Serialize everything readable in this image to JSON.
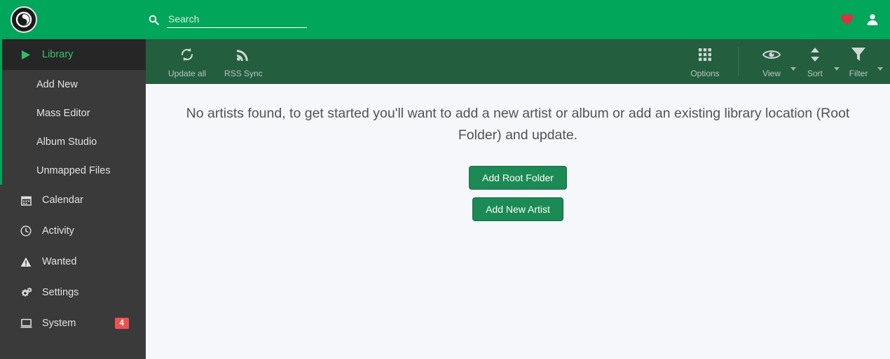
{
  "header": {
    "logo_icon": "lidarr-logo-icon",
    "search": {
      "placeholder": "Search",
      "value": "",
      "icon": "search-icon"
    },
    "donate_icon": "heart-icon",
    "account_icon": "user-icon"
  },
  "sidebar": {
    "groups": [
      {
        "active": true,
        "label": "Library",
        "icon": "play-triangle-icon",
        "children": [
          {
            "label": "Add New"
          },
          {
            "label": "Mass Editor"
          },
          {
            "label": "Album Studio"
          },
          {
            "label": "Unmapped Files"
          }
        ]
      }
    ],
    "items": [
      {
        "label": "Calendar",
        "icon": "calendar-icon"
      },
      {
        "label": "Activity",
        "icon": "clock-icon"
      },
      {
        "label": "Wanted",
        "icon": "warning-triangle-icon"
      },
      {
        "label": "Settings",
        "icon": "gears-icon"
      },
      {
        "label": "System",
        "icon": "monitor-icon",
        "badge": "4"
      }
    ]
  },
  "toolbar": {
    "left": [
      {
        "label": "Update all",
        "icon": "refresh-icon"
      },
      {
        "label": "RSS Sync",
        "icon": "rss-icon"
      }
    ],
    "right": [
      {
        "label": "Options",
        "icon": "grid-icon",
        "caret": false
      },
      {
        "label": "View",
        "icon": "eye-icon",
        "caret": true
      },
      {
        "label": "Sort",
        "icon": "sort-arrows-icon",
        "caret": true
      },
      {
        "label": "Filter",
        "icon": "funnel-icon",
        "caret": true
      }
    ]
  },
  "main": {
    "empty_message": "No artists found, to get started you'll want to add a new artist or album or add an existing library location (Root Folder) and update.",
    "buttons": [
      {
        "label": "Add Root Folder"
      },
      {
        "label": "Add New Artist"
      }
    ]
  },
  "colors": {
    "header_green": "#00a65a",
    "toolbar_green": "#235e3f",
    "sidebar_dark": "#3a3a3a",
    "sidebar_active": "#262626",
    "accent_green": "#35c46f",
    "badge_red": "#f05050",
    "button_green": "#1b8a54",
    "content_bg": "#f5f7fa"
  }
}
